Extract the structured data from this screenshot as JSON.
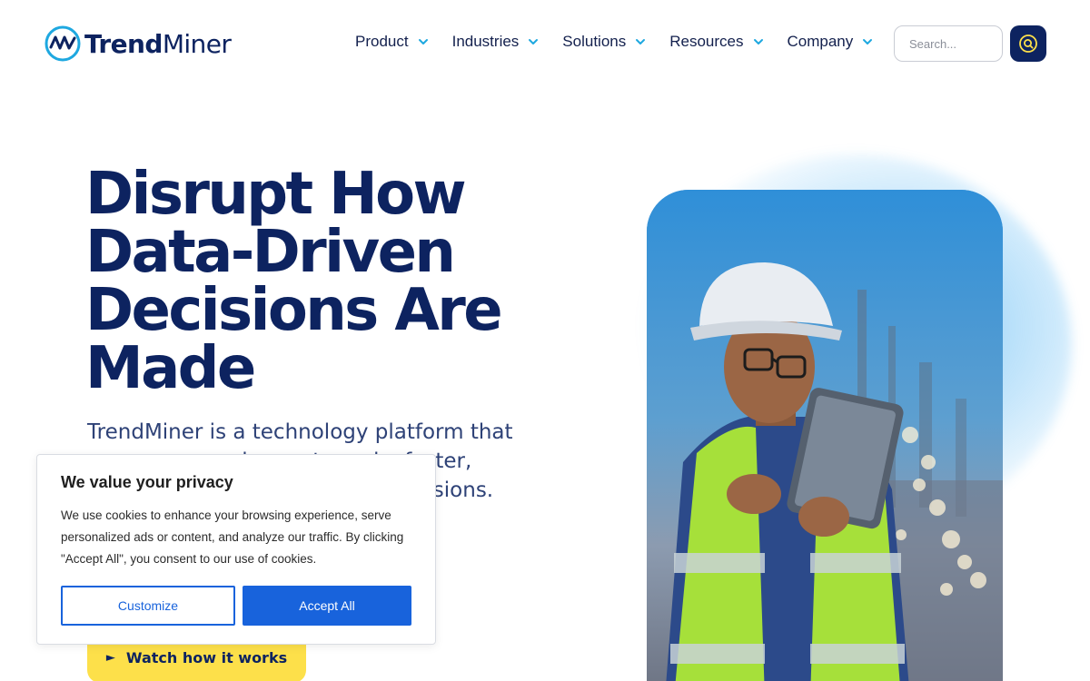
{
  "brand": {
    "name_part1": "Trend",
    "name_part2": "Miner",
    "color_navy": "#0d2360",
    "color_cyan": "#1ea8e0",
    "color_yellow": "#fde04a"
  },
  "nav": {
    "items": [
      {
        "label": "Product",
        "icon": "chevron-down-icon"
      },
      {
        "label": "Industries",
        "icon": "chevron-down-icon"
      },
      {
        "label": "Solutions",
        "icon": "chevron-down-icon"
      },
      {
        "label": "Resources",
        "icon": "chevron-down-icon"
      },
      {
        "label": "Company",
        "icon": "chevron-down-icon"
      }
    ],
    "search": {
      "placeholder": "Search...",
      "icon": "search-icon"
    }
  },
  "hero": {
    "title_lines": [
      "Disrupt How",
      "Data-Driven",
      "Decisions Are",
      "Made"
    ],
    "description": "TrendMiner is a technology platform that empowers engineers to make faster, smarter and more profitable decisions. Achieve excellence with",
    "cta_label": "Watch how it works",
    "cta_icon": "play-icon"
  },
  "cookie_banner": {
    "title": "We value your privacy",
    "text": "We use cookies to enhance your browsing experience, serve personalized ads or content, and analyze our traffic. By clicking \"Accept All\", you consent to our use of cookies.",
    "customize_label": "Customize",
    "accept_label": "Accept All",
    "accent_color": "#1863dc"
  }
}
